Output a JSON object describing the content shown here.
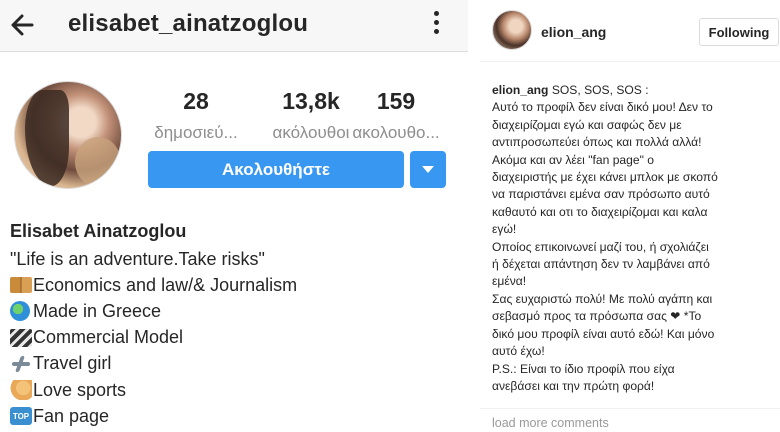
{
  "left": {
    "title": "elisabet_ainatzoglou",
    "stats": [
      {
        "number": "28",
        "label": "δημοσιεύ..."
      },
      {
        "number": "13,8k",
        "label": "ακόλουθοι"
      },
      {
        "number": "159",
        "label": "ακολουθο..."
      }
    ],
    "follow_label": "Ακολουθήστε",
    "bio": {
      "name": "Elisabet Ainatzoglou",
      "lines": [
        {
          "icon": "",
          "text": "\"Life is an adventure.Take risks\""
        },
        {
          "icon": "open-book-icon",
          "text": "Economics and law/& Journalism"
        },
        {
          "icon": "globe-icon",
          "text": "Made in Greece"
        },
        {
          "icon": "clapper-board-icon",
          "text": "Commercial Model"
        },
        {
          "icon": "airplane-icon",
          "text": "Travel girl"
        },
        {
          "icon": "flexed-biceps-icon",
          "text": "Love sports"
        },
        {
          "icon": "top-icon",
          "text": "Fan page"
        }
      ],
      "top_badge": "TOP"
    }
  },
  "right": {
    "username": "elion_ang",
    "following_label": "Following",
    "caption_author": "elion_ang",
    "caption_lines": [
      " SOS, SOS, SOS :",
      "Αυτό το προφίλ δεν είναι δικό μου! Δεν το",
      "διαχειρίζομαι εγώ και σαφώς δεν με",
      "αντιπροσωπεύει όπως και πολλά αλλά!",
      "Ακόμα και αν λέει \"fan page\" ο",
      "διαχειριστής με έχει κάνει μπλοκ με σκοπό",
      "να παριστάνει εμένα σαν πρόσωπο αυτό",
      "καθαυτό και οτι το διαχειρίζομαι και καλα",
      "εγώ!",
      "Οποίος επικοινωνεί μαζί του, ή σχολιάζει",
      "ή δέχεται απάντηση δεν τν λαμβάνει από",
      "εμένα!",
      "Σας ευχαριστώ πολύ! Με πολύ αγάπη και",
      "σεβασμό προς τα πρόσωπα σας ❤ *Το",
      "δικό μου προφίλ είναι αυτό εδώ! Και μόνο",
      "αυτό έχω!",
      "P.S.: Είναι το ίδιο προφίλ που είχα",
      "ανεβάσει και την πρώτη φορά!"
    ],
    "load_more": "load more comments"
  },
  "colors": {
    "accent": "#3897f0",
    "text": "#262626",
    "muted": "#8e8e8e",
    "topbar": "#f7f7f7"
  }
}
